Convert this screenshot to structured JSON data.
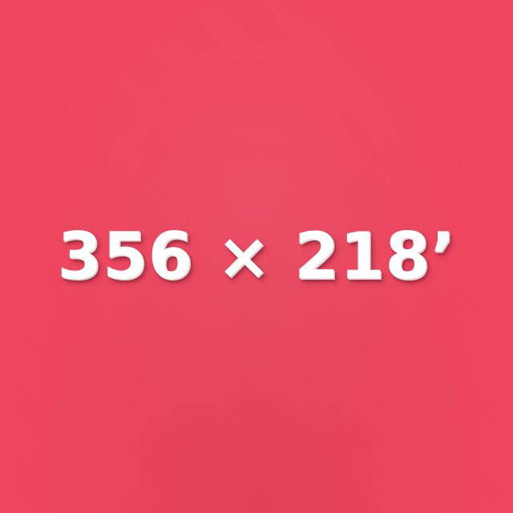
{
  "scene": {
    "background_color": "#f0455e",
    "text_color": "#ffffff",
    "expression": "356 × 218’"
  }
}
